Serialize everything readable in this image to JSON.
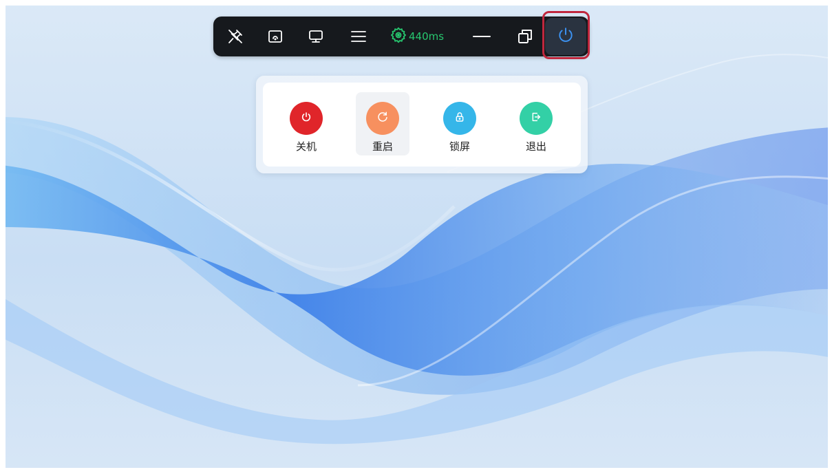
{
  "toolbar": {
    "icons": [
      "pin-off-icon",
      "cast-icon",
      "monitor-icon",
      "menu-icon",
      "gear-icon",
      "minimize-icon",
      "restore-window-icon",
      "power-icon"
    ],
    "latency_text": "440ms",
    "latency_color": "#27c76f"
  },
  "power_menu": {
    "items": [
      {
        "label": "关机",
        "icon": "power-icon",
        "color": "#e0252a"
      },
      {
        "label": "重启",
        "icon": "refresh-icon",
        "color": "#f7905f"
      },
      {
        "label": "锁屏",
        "icon": "lock-icon",
        "color": "#35b6e9"
      },
      {
        "label": "退出",
        "icon": "logout-icon",
        "color": "#33d0a6"
      }
    ]
  },
  "colors": {
    "toolbar_bg": "#16191d",
    "highlight": "#c0273d",
    "power_icon": "#3c93f3"
  }
}
